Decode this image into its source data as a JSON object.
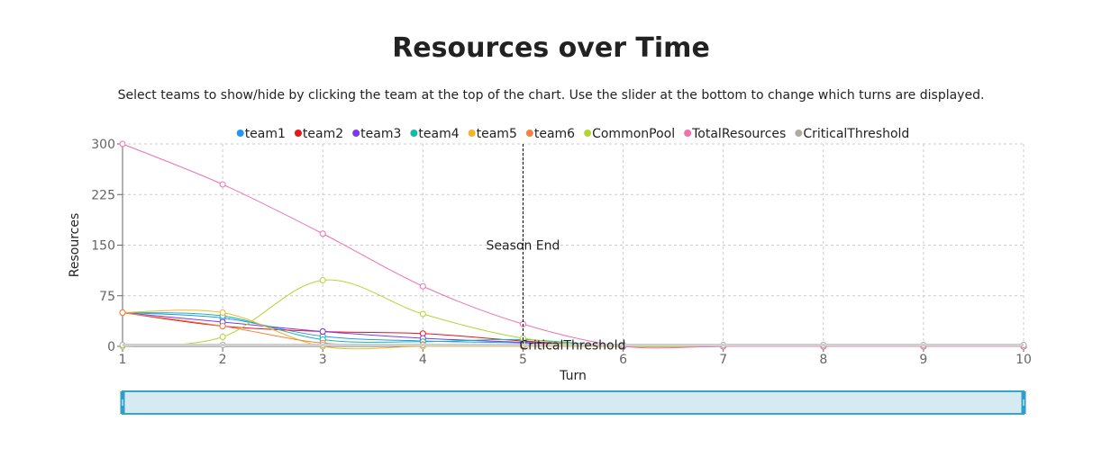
{
  "header": {
    "title": "Resources over Time",
    "subtitle": "Select teams to show/hide by clicking the team at the top of the chart. Use the slider at the bottom to change which turns are displayed."
  },
  "chart_data": {
    "type": "line",
    "xlabel": "Turn",
    "ylabel": "Resources",
    "xlim": [
      1,
      10
    ],
    "ylim": [
      0,
      300
    ],
    "yticks": [
      0,
      75,
      150,
      225,
      300
    ],
    "xticks": [
      1,
      2,
      3,
      4,
      5,
      6,
      7,
      8,
      9,
      10
    ],
    "grid": true,
    "legend_position": "top",
    "x": [
      1,
      2,
      3,
      4,
      5,
      6,
      7,
      8,
      9,
      10
    ],
    "series": [
      {
        "name": "team1",
        "color": "#2196f3",
        "values": [
          50,
          42,
          15,
          8,
          5,
          0,
          0,
          0,
          0,
          0
        ]
      },
      {
        "name": "team2",
        "color": "#e8141b",
        "values": [
          50,
          30,
          22,
          19,
          8,
          0,
          0,
          0,
          0,
          0
        ]
      },
      {
        "name": "team3",
        "color": "#7b3bea",
        "values": [
          50,
          36,
          22,
          12,
          6,
          0,
          0,
          0,
          0,
          0
        ]
      },
      {
        "name": "team4",
        "color": "#17b8a6",
        "values": [
          50,
          45,
          10,
          7,
          10,
          0,
          0,
          0,
          0,
          0
        ]
      },
      {
        "name": "team5",
        "color": "#f5b32a",
        "values": [
          50,
          50,
          0,
          0,
          0,
          0,
          0,
          0,
          0,
          0
        ]
      },
      {
        "name": "team6",
        "color": "#f28445",
        "values": [
          50,
          30,
          5,
          3,
          2,
          0,
          0,
          0,
          0,
          0
        ]
      },
      {
        "name": "CommonPool",
        "color": "#b5d334",
        "values": [
          0,
          14,
          98,
          48,
          12,
          0,
          0,
          0,
          0,
          0
        ]
      },
      {
        "name": "TotalResources",
        "color": "#f070b0",
        "values": [
          300,
          240,
          167,
          89,
          33,
          0,
          0,
          0,
          0,
          0
        ]
      },
      {
        "name": "CriticalThreshold",
        "color": "#b0aaa5",
        "values": [
          2,
          2,
          2,
          2,
          2,
          2,
          2,
          2,
          2,
          2
        ]
      }
    ],
    "annotations": [
      {
        "type": "vline",
        "x": 5,
        "label": "Season End"
      },
      {
        "type": "hline",
        "y": 2,
        "label": "CriticalThreshold"
      }
    ],
    "brush": {
      "range": [
        1,
        10
      ]
    }
  }
}
